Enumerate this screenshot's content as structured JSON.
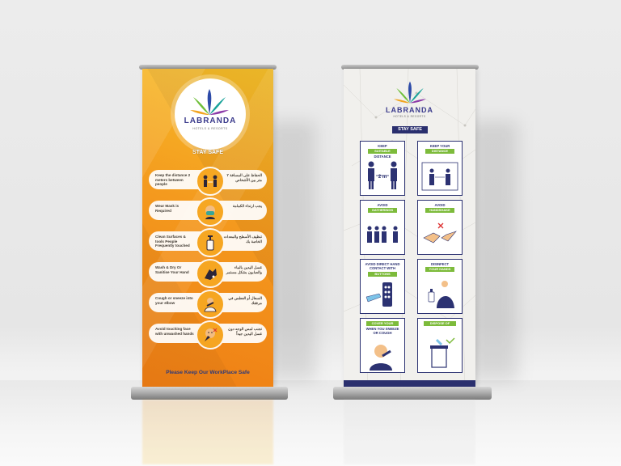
{
  "left_banner": {
    "brand": "LABRANDA",
    "brand_sub": "HOTELS & RESORTS",
    "stay_safe": "STAY SAFE",
    "tips": [
      {
        "en": "Keep the distance 2 meters between people",
        "ar": "الحفاظ على المسافة ٢ متر بين الأشخاص",
        "icon": "distance-icon"
      },
      {
        "en": "Wear Mask is Required",
        "ar": "يجب ارتداء الكمامة",
        "icon": "mask-icon"
      },
      {
        "en": "Clean Surfaces & tools People Frequently touched",
        "ar": "تنظيف الأسطح والمعدات الخاصة بك",
        "icon": "sanitizer-icon"
      },
      {
        "en": "Wash & Dry Or Sanitise Your Hand",
        "ar": "غسل اليدين بالماء والصابون بشكل مستمر",
        "icon": "handwash-icon"
      },
      {
        "en": "Cough or sneeze into your elbow",
        "ar": "السعال أو العطس في مرفقك",
        "icon": "cough-icon"
      },
      {
        "en": "Avoid touching face with unwashed hands",
        "ar": "تجنب لمس الوجه دون غسل اليدين جيداً",
        "icon": "face-touch-icon"
      }
    ],
    "footer": "Please Keep Our WorkPlace Safe"
  },
  "right_banner": {
    "brand": "LABRANDA",
    "brand_sub": "HOTELS & RESORTS",
    "stay_safe": "STAY SAFE",
    "cards": [
      {
        "line1": "KEEP",
        "tag": "SUITABLE",
        "line2": "DISTANCE",
        "art": "2 m",
        "icon": "distance-icon"
      },
      {
        "line1": "KEEP YOUR",
        "tag": "DISTANCE",
        "line2": "",
        "art": "",
        "icon": "distance-icon"
      },
      {
        "line1": "AVOID",
        "tag": "GATHERINGS",
        "line2": "",
        "art": "",
        "icon": "crowd-icon"
      },
      {
        "line1": "AVOID",
        "tag": "HANDSHAKE",
        "line2": "",
        "art": "",
        "icon": "handshake-icon"
      },
      {
        "line1": "AVOID DIRECT HAND CONTACT WITH",
        "tag": "BUTTONS",
        "line2": "",
        "art": "",
        "icon": "buttons-icon"
      },
      {
        "line1": "DISINFECT",
        "tag": "YOUR HANDS",
        "line2": "",
        "art": "",
        "icon": "disinfect-icon"
      },
      {
        "line1": "",
        "tag": "COVER YOUR MOUTH",
        "line2": "WHEN YOU SNEEZE OR COUGH",
        "art": "",
        "icon": "sneeze-icon"
      },
      {
        "line1": "",
        "tag": "DISPOSE OF TISSUES",
        "line2": "",
        "art": "",
        "icon": "bin-icon"
      }
    ]
  },
  "colors": {
    "orange_top": "#f7c02a",
    "orange_bottom": "#ef7d14",
    "navy": "#2c3272",
    "green": "#7dbb3b",
    "teal": "#2aa6a0"
  }
}
